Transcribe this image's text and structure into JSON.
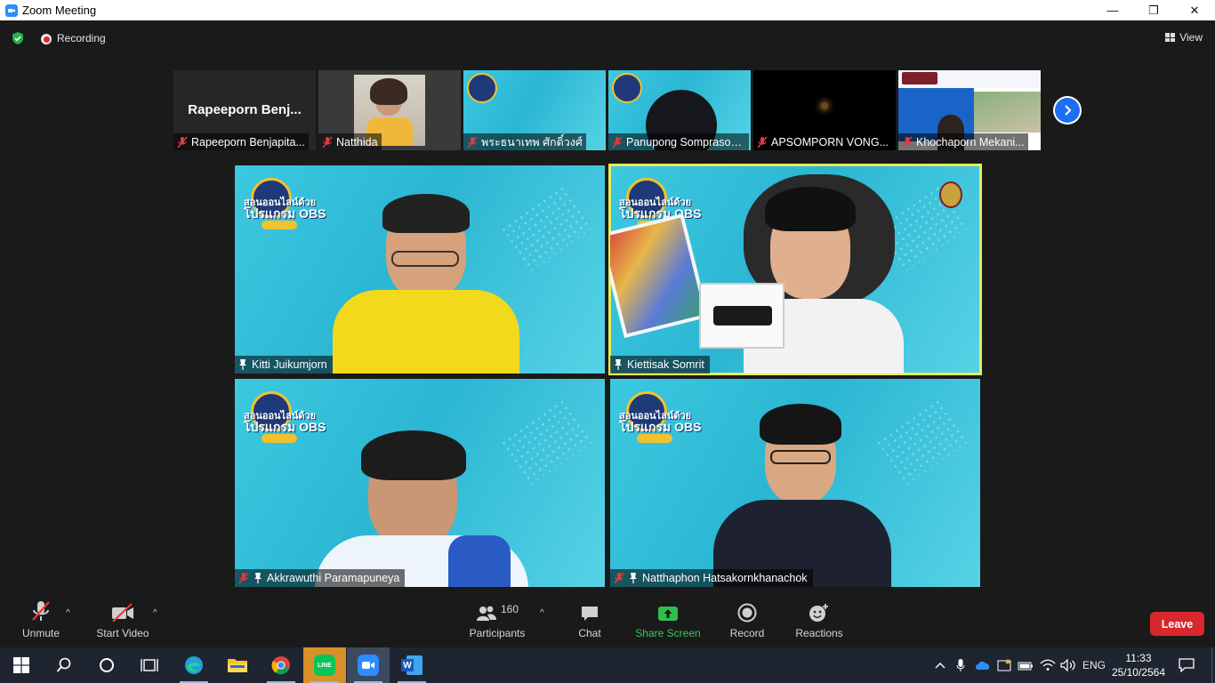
{
  "window": {
    "title": "Zoom Meeting",
    "controls": {
      "minimize": "—",
      "maximize": "❐",
      "close": "✕"
    }
  },
  "topbar": {
    "recording_label": "Recording",
    "view_label": "View"
  },
  "thumbnails": [
    {
      "display_name": "Rapeeporn Benjapita...",
      "big_text": "Rapeeporn  Benj...",
      "muted": true,
      "video": false
    },
    {
      "display_name": "Natthida",
      "muted": true,
      "video": true
    },
    {
      "display_name": "พระธนาเทพ ศักดิ์วงศ์",
      "muted": true,
      "video": true
    },
    {
      "display_name": "Panupong Somprason...",
      "muted": true,
      "video": true
    },
    {
      "display_name": "APSOMPORN VONG...",
      "muted": true,
      "video": true
    },
    {
      "display_name": "Khochaporn Mekani...",
      "muted": true,
      "video": true
    }
  ],
  "tiles": [
    {
      "name": "Kitti Juikumjorn",
      "muted": false,
      "pinned": true,
      "active": false,
      "shirt": "#f3d91b"
    },
    {
      "name": "Kiettisak Somrit",
      "muted": false,
      "pinned": true,
      "active": true,
      "shirt": "#f2f2f2"
    },
    {
      "name": "Akkrawuthi Paramapuneya",
      "muted": true,
      "pinned": true,
      "active": false,
      "shirt": "#eef4fb"
    },
    {
      "name": "Natthaphon Hatsakornkhanachok",
      "muted": true,
      "pinned": true,
      "active": false,
      "shirt": "#1e2230"
    }
  ],
  "banner": {
    "line1": "สอนออนไลน์ด้วย",
    "line2": "โปรแกรม OBS"
  },
  "toolbar": {
    "unmute_label": "Unmute",
    "start_video_label": "Start Video",
    "participants_label": "Participants",
    "participants_count": "160",
    "chat_label": "Chat",
    "share_screen_label": "Share Screen",
    "record_label": "Record",
    "reactions_label": "Reactions",
    "leave_label": "Leave"
  },
  "taskbar": {
    "language": "ENG",
    "time": "11:33",
    "date": "25/10/2564",
    "line_app_label": "LINE"
  },
  "colors": {
    "accent_blue": "#2d8cff",
    "leave_red": "#d9272e",
    "share_green": "#34c759",
    "active_speaker": "#e6ec5a"
  }
}
